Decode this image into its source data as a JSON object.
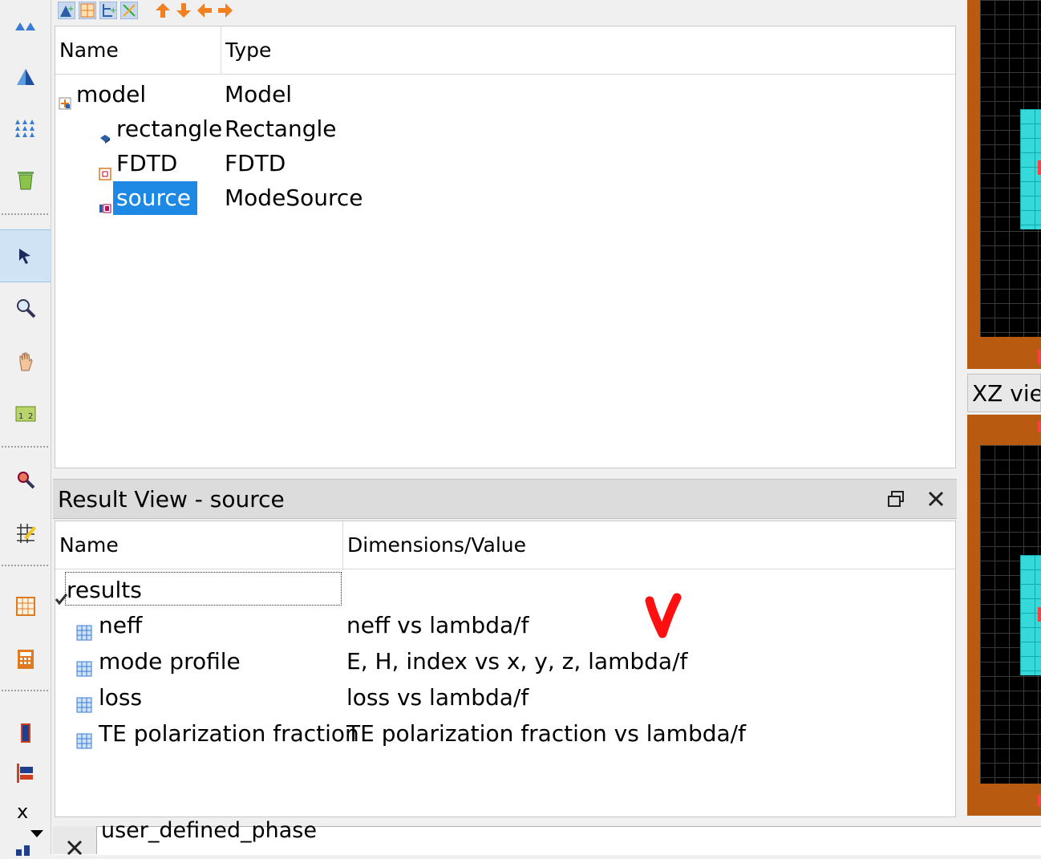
{
  "objects_tree": {
    "columns": [
      "Name",
      "Type"
    ],
    "rows": [
      {
        "name": "model",
        "type": "Model"
      },
      {
        "name": "rectangle",
        "type": "Rectangle"
      },
      {
        "name": "FDTD",
        "type": "FDTD"
      },
      {
        "name": "source",
        "type": "ModeSource",
        "selected": true
      }
    ]
  },
  "result_view": {
    "title": "Result View - source",
    "columns": [
      "Name",
      "Dimensions/Value"
    ],
    "group": "results",
    "rows": [
      {
        "name": "neff",
        "value": "neff vs lambda/f"
      },
      {
        "name": "mode profile",
        "value": "E, H, index vs x, y, z, lambda/f"
      },
      {
        "name": "loss",
        "value": "loss vs lambda/f"
      },
      {
        "name": "TE polarization fraction",
        "value": "TE polarization fraction vs lambda/f"
      }
    ]
  },
  "right_view": {
    "xz_title": "XZ view"
  },
  "left_toolbar": {
    "axis_label": "x"
  },
  "bottom": {
    "script_line": "user_defined_phase"
  },
  "icons": [
    "double-triangle-icon",
    "triangle-icon",
    "array-icon",
    "trash-icon",
    "select-arrow-icon",
    "zoom-icon",
    "pan-hand-icon",
    "ruler-icon",
    "zoom-extent-icon",
    "edit-grid-icon",
    "grid-icon",
    "calculator-icon",
    "source-bar-icon",
    "monitor-icon"
  ],
  "colors": {
    "selection": "#1e88e5",
    "annotation": "#ff0000",
    "substrate": "#b85a10",
    "waveguide": "#36d9d9"
  }
}
